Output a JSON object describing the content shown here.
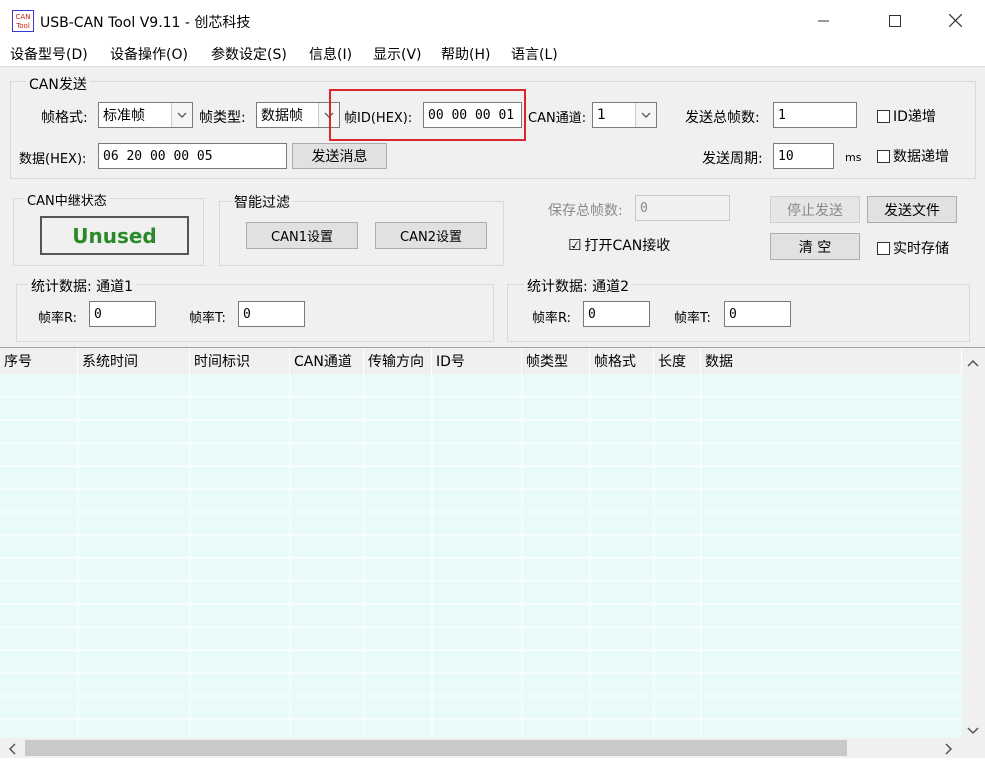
{
  "window": {
    "title": "USB-CAN Tool V9.11 - 创芯科技",
    "icon_text_top": "CAN",
    "icon_text_bottom": "Tool"
  },
  "menu": [
    "设备型号(D)",
    "设备操作(O)",
    "参数设定(S)",
    "信息(I)",
    "显示(V)",
    "帮助(H)",
    "语言(L)"
  ],
  "can_send": {
    "group_title": "CAN发送",
    "frame_format_label": "帧格式:",
    "frame_format_value": "标准帧",
    "frame_type_label": "帧类型:",
    "frame_type_value": "数据帧",
    "frame_id_label": "帧ID(HEX):",
    "frame_id_value": "00 00 00 01",
    "can_channel_label": "CAN通道:",
    "can_channel_value": "1",
    "total_frames_label": "发送总帧数:",
    "total_frames_value": "1",
    "id_increment_label": "ID递增",
    "data_label": "数据(HEX):",
    "data_value": "06 20 00 00 05",
    "send_button": "发送消息",
    "period_label": "发送周期:",
    "period_value": "10",
    "period_unit": "ms",
    "data_increment_label": "数据递增",
    "highlight_color": "#d9262c"
  },
  "relay": {
    "group_title": "CAN中继状态",
    "status": "Unused",
    "status_color": "#2a8a2a"
  },
  "filter": {
    "group_title": "智能过滤",
    "can1_button": "CAN1设置",
    "can2_button": "CAN2设置"
  },
  "controls": {
    "save_total_label": "保存总帧数:",
    "save_total_value": "0",
    "open_receive_label": "打开CAN接收",
    "open_receive_checked": "☑",
    "stop_send_button": "停止发送",
    "send_file_button": "发送文件",
    "clear_button": "清 空",
    "realtime_save_label": "实时存储"
  },
  "stats1": {
    "group_title": "统计数据: 通道1",
    "rate_r_label": "帧率R:",
    "rate_r_value": "0",
    "rate_t_label": "帧率T:",
    "rate_t_value": "0"
  },
  "stats2": {
    "group_title": "统计数据: 通道2",
    "rate_r_label": "帧率R:",
    "rate_r_value": "0",
    "rate_t_label": "帧率T:",
    "rate_t_value": "0"
  },
  "table": {
    "columns": [
      "序号",
      "系统时间",
      "时间标识",
      "CAN通道",
      "传输方向",
      "ID号",
      "帧类型",
      "帧格式",
      "长度",
      "数据"
    ],
    "row_background": "#e8fbf8"
  }
}
